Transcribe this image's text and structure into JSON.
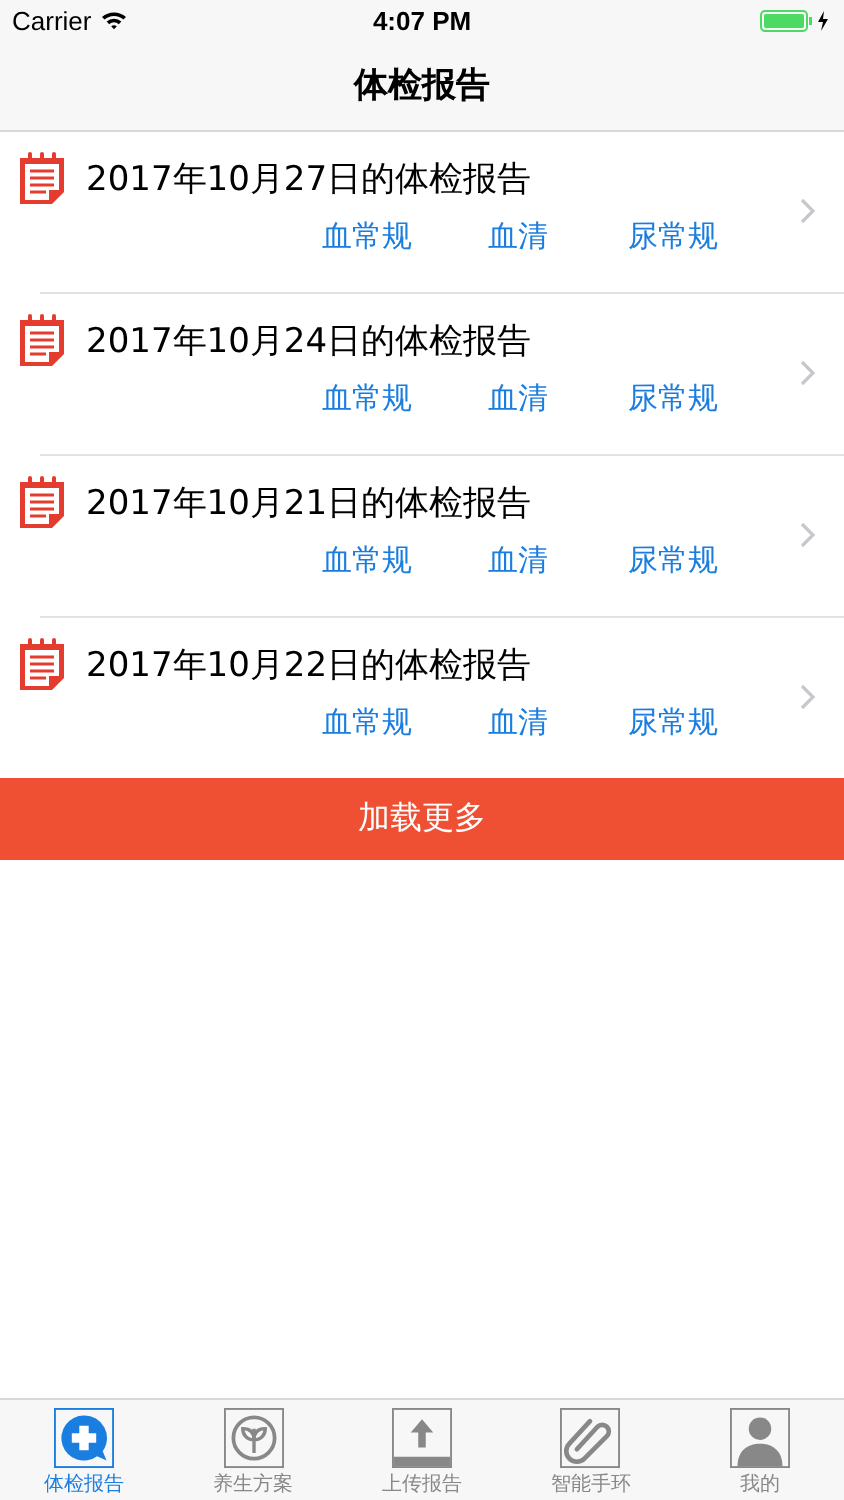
{
  "status_bar": {
    "carrier": "Carrier",
    "time": "4:07 PM"
  },
  "nav_bar": {
    "title": "体检报告"
  },
  "reports": [
    {
      "title": "2017年10月27日的体检报告",
      "links": [
        "血常规",
        "血清",
        "尿常规"
      ]
    },
    {
      "title": "2017年10月24日的体检报告",
      "links": [
        "血常规",
        "血清",
        "尿常规"
      ]
    },
    {
      "title": "2017年10月21日的体检报告",
      "links": [
        "血常规",
        "血清",
        "尿常规"
      ]
    },
    {
      "title": "2017年10月22日的体检报告",
      "links": [
        "血常规",
        "血清",
        "尿常规"
      ]
    }
  ],
  "load_more_button": {
    "label": "加载更多"
  },
  "tab_bar": [
    {
      "label": "体检报告",
      "kind": "checkup",
      "selected": true
    },
    {
      "label": "养生方案",
      "kind": "leaf",
      "selected": false
    },
    {
      "label": "上传报告",
      "kind": "upload",
      "selected": false
    },
    {
      "label": "智能手环",
      "kind": "clip",
      "selected": false
    },
    {
      "label": "我的",
      "kind": "person",
      "selected": false
    }
  ]
}
